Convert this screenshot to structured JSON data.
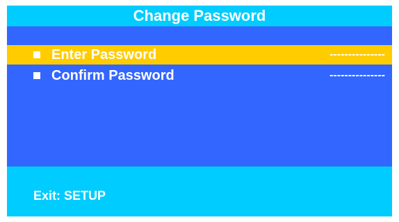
{
  "title": "Change Password",
  "menu": {
    "items": [
      {
        "label": "Enter Password",
        "value": "---------------",
        "selected": true
      },
      {
        "label": "Confirm Password",
        "value": "---------------",
        "selected": false
      }
    ]
  },
  "footer": {
    "hint": "Exit: SETUP"
  },
  "colors": {
    "title_bar": "#00ccff",
    "menu_background": "#3366ff",
    "selected_row": "#ffcc00",
    "text": "#ffffff"
  },
  "icons": {
    "bullet": "square-bullet-icon"
  }
}
